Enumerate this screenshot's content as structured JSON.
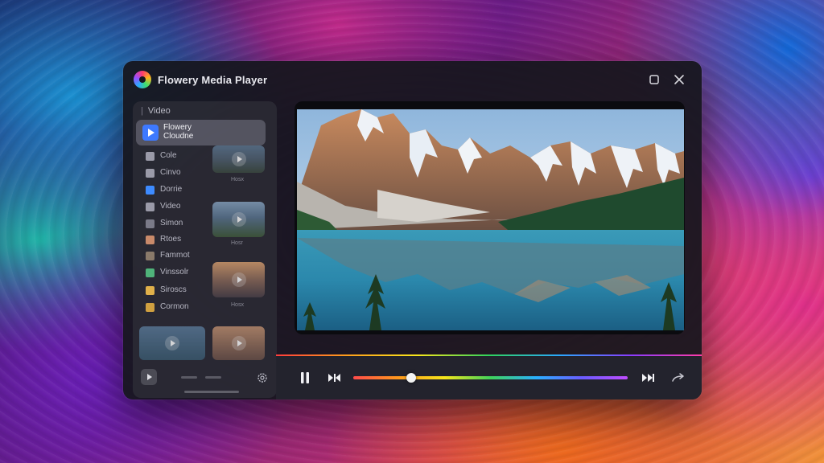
{
  "app": {
    "title": "Flowery Media Player"
  },
  "window_controls": {
    "maximize_icon": "square-icon",
    "close_icon": "close-icon"
  },
  "sidebar": {
    "header": "Video",
    "active_item": {
      "label": "Flowery Cloudne",
      "icon": "play-icon",
      "color": "#3d79ff"
    },
    "items": [
      {
        "label": "Cole",
        "icon": "rewind-icon",
        "color": "#9a9aa8"
      },
      {
        "label": "Cinvo",
        "icon": "thumbs-up-icon",
        "color": "#9a9aa8"
      },
      {
        "label": "Dorrie",
        "icon": "cloud-icon",
        "color": "#3d8bff"
      },
      {
        "label": "Video",
        "icon": "link-icon",
        "color": "#9a9aa8"
      },
      {
        "label": "Simon",
        "icon": "file-icon",
        "color": "#7a7a88"
      },
      {
        "label": "Rtoes",
        "icon": "photo-icon",
        "color": "#c98a6a"
      },
      {
        "label": "Fammot",
        "icon": "image-icon",
        "color": "#8a7a6a"
      },
      {
        "label": "Vinssolr",
        "icon": "landscape-icon",
        "color": "#4fb37a"
      },
      {
        "label": "Siroscs",
        "icon": "collage-icon",
        "color": "#e0b04a"
      },
      {
        "label": "Cormon",
        "icon": "flower-icon",
        "color": "#d0a040"
      }
    ],
    "thumb_captions": [
      "Hosx",
      "Hosr",
      "Hosx"
    ]
  },
  "player": {
    "progress_fraction": 0.21,
    "controls": {
      "pause_icon": "pause-icon",
      "prev_icon": "skip-back-icon",
      "next_icon": "skip-forward-icon",
      "share_icon": "share-icon"
    },
    "accent_gradient": [
      "#ff4b4b",
      "#ff9a1c",
      "#f6e61c",
      "#3fd35a",
      "#2ab0ff",
      "#6a5cff",
      "#c04cff"
    ]
  }
}
